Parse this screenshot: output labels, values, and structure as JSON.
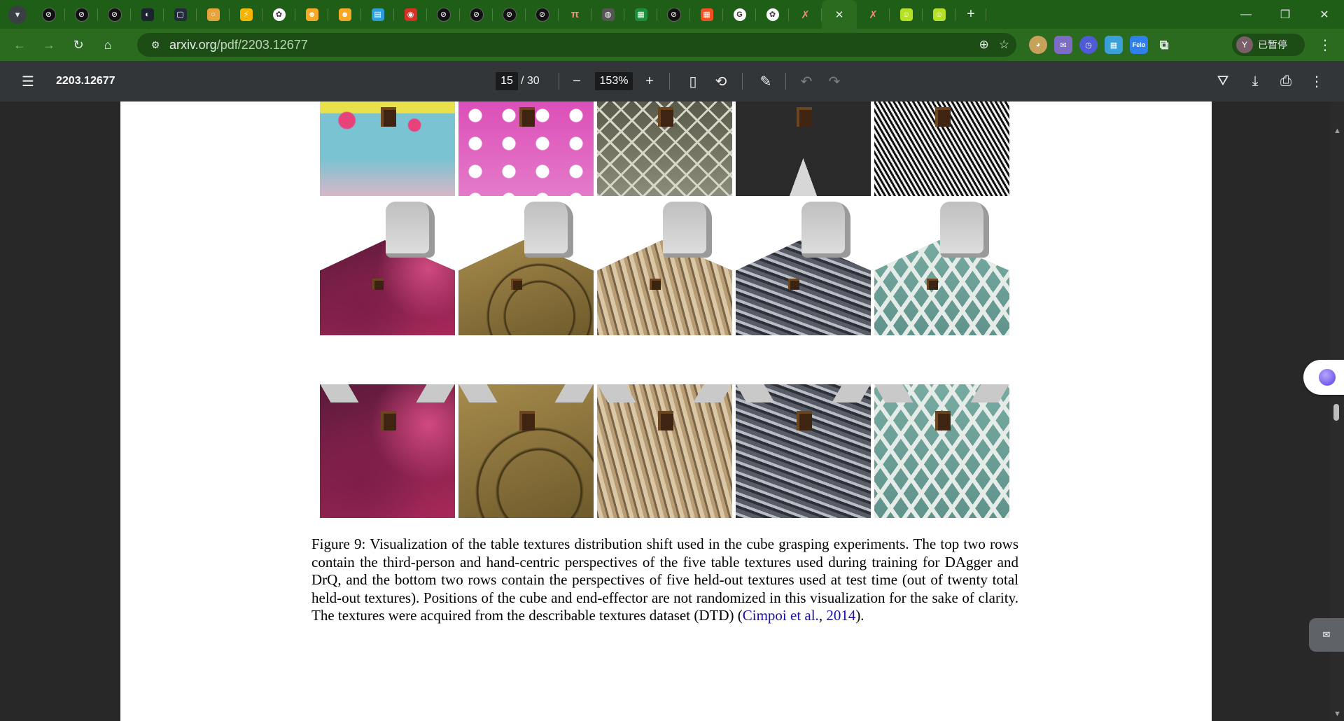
{
  "browser": {
    "tabs": [
      {
        "icon": "notion-icon",
        "color": "#111111",
        "glyph": "⊘"
      },
      {
        "icon": "notion-icon",
        "color": "#111111",
        "glyph": "⊘"
      },
      {
        "icon": "notion-icon",
        "color": "#111111",
        "glyph": "⊘"
      },
      {
        "icon": "github-icon",
        "color": "#1c2330",
        "glyph": "◐"
      },
      {
        "icon": "app-icon",
        "color": "#232b3a",
        "glyph": "▢"
      },
      {
        "icon": "ring-icon",
        "color": "#e8a33b",
        "glyph": "○"
      },
      {
        "icon": "lightning-icon",
        "color": "#f4b400",
        "glyph": "⚡"
      },
      {
        "icon": "openai-icon",
        "color": "#ffffff",
        "glyph": "✿"
      },
      {
        "icon": "huggingface-icon",
        "color": "#f9a825",
        "glyph": "☻"
      },
      {
        "icon": "huggingface-icon",
        "color": "#f9a825",
        "glyph": "☻"
      },
      {
        "icon": "docs-icon",
        "color": "#2d9cdb",
        "glyph": "▤"
      },
      {
        "icon": "red-logo-icon",
        "color": "#d93025",
        "glyph": "◉"
      },
      {
        "icon": "notion-icon",
        "color": "#111111",
        "glyph": "⊘"
      },
      {
        "icon": "notion-icon",
        "color": "#111111",
        "glyph": "⊘"
      },
      {
        "icon": "notion-icon",
        "color": "#111111",
        "glyph": "⊘"
      },
      {
        "icon": "notion-icon",
        "color": "#111111",
        "glyph": "⊘"
      },
      {
        "icon": "pi-icon",
        "color": "#1e5e16",
        "glyph": "π"
      },
      {
        "icon": "globe-icon",
        "color": "#555555",
        "glyph": "◍"
      },
      {
        "icon": "sheets-icon",
        "color": "#1e8e3e",
        "glyph": "▦"
      },
      {
        "icon": "notion-icon",
        "color": "#111111",
        "glyph": "⊘"
      },
      {
        "icon": "microsoft-icon",
        "color": "#f25022",
        "glyph": "▦"
      },
      {
        "icon": "google-icon",
        "color": "#ffffff",
        "glyph": "G"
      },
      {
        "icon": "openai-icon",
        "color": "#ffffff",
        "glyph": "✿"
      },
      {
        "icon": "x-icon",
        "color": "#1e5e16",
        "glyph": "✗"
      },
      {
        "icon": "close-icon",
        "color": "#2a6b1f",
        "glyph": "✕",
        "active": true
      },
      {
        "icon": "x-icon",
        "color": "#1e5e16",
        "glyph": "✗"
      },
      {
        "icon": "smiley-icon",
        "color": "#b6e024",
        "glyph": "☺"
      },
      {
        "icon": "smiley-icon",
        "color": "#b6e024",
        "glyph": "☺"
      }
    ],
    "new_tab": "+",
    "url_host": "arxiv.org",
    "url_path": "/pdf/2203.12677",
    "profile_initial": "Y",
    "profile_label": "已暂停"
  },
  "pdf_toolbar": {
    "title": "2203.12677",
    "page_current": "15",
    "page_total": "/ 30",
    "zoom": "153%"
  },
  "figure": {
    "caption_lead": "Figure 9:  Visualization of the table textures distribution shift used in the cube grasping experiments.  The top two rows contain the third-person and hand-centric perspectives of the five table textures used during training for DAgger and DrQ, and the bottom two rows contain the perspectives of five held-out textures used at test time (out of twenty total held-out textures).  Positions of the cube and end-effector are not randomized in this visualization for the sake of clarity.  The textures were acquired from the describable textures dataset (DTD) (",
    "citation_author": "Cimpoi et al.",
    "citation_sep": ", ",
    "citation_year": "2014",
    "caption_tail": ").",
    "textures": {
      "row_top": [
        "floral-pink-blue",
        "polka-dot-pink",
        "diamond-mesh",
        "black-triangles",
        "bw-woven"
      ],
      "row_third_person": [
        "magenta-paisley",
        "wood-swirl",
        "rock-marble",
        "gray-stone",
        "teal-pattern"
      ],
      "row_hand_centric": [
        "magenta-paisley",
        "wood-swirl",
        "rock-marble",
        "gray-stone",
        "teal-pattern"
      ]
    }
  }
}
